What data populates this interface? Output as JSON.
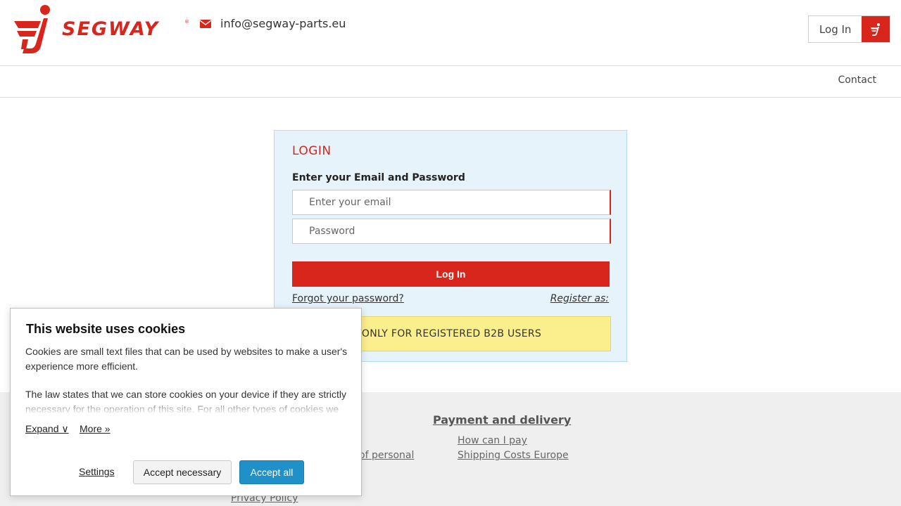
{
  "header": {
    "logo_text": "SEGWAY",
    "logo_reg": "®",
    "email": "info@segway-parts.eu",
    "login_label": "Log In"
  },
  "nav": {
    "contact": "Contact"
  },
  "login": {
    "title": "LOGIN",
    "subtitle": "Enter your Email and Password",
    "email_placeholder": "Enter your email",
    "password_placeholder": "Password",
    "submit_label": "Log In",
    "forgot_label": "Forgot your password?",
    "register_label": "Register as:",
    "b2b_notice": "ONLY FOR REGISTERED B2B USERS"
  },
  "footer": {
    "heading": "Payment and delivery",
    "links_right": [
      "How can I pay",
      "Shipping Costs Europe"
    ],
    "partial_link": "of personal",
    "privacy": "Privacy Policy"
  },
  "cookie": {
    "title": "This website uses cookies",
    "paragraph1": "Cookies are small text files that can be used by websites to make a user's experience more efficient.",
    "paragraph2": "The law states that we can store cookies on your device if they are strictly necessary for the operation of this site. For all other types of cookies we",
    "expand_label": "Expand ∨",
    "more_label": "More »",
    "settings_label": "Settings",
    "accept_necessary_label": "Accept necessary",
    "accept_all_label": "Accept all"
  },
  "colors": {
    "brand_red": "#d9261c",
    "login_bg": "#e6f3fb",
    "notice_yellow": "#fbee8c",
    "accept_blue": "#1f91c8"
  }
}
